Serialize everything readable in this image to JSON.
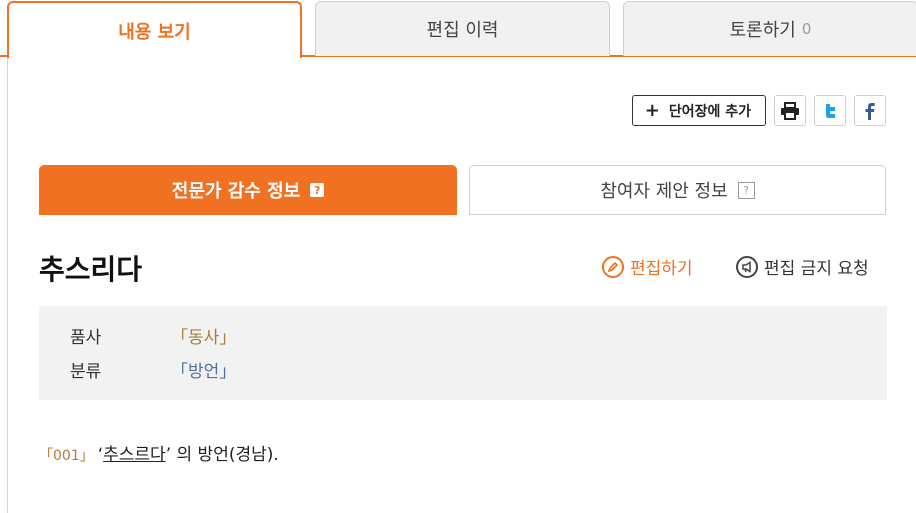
{
  "tabs": {
    "view": "내용 보기",
    "history": "편집 이력",
    "discuss": "토론하기",
    "discuss_count": "0"
  },
  "toolbar": {
    "add_vocab": "단어장에 추가",
    "add_vocab_symbol": "+",
    "print_icon": "printer-icon",
    "twitter_icon": "twitter-icon",
    "facebook_icon": "facebook-icon"
  },
  "subtabs": {
    "expert": "전문가 감수 정보",
    "participant": "참여자 제안 정보",
    "help_mark": "?"
  },
  "entry": {
    "word": "추스리다",
    "edit": "편집하기",
    "ban_request": "편집 금지 요청"
  },
  "info": {
    "pos_label": "품사",
    "pos_value": "「동사」",
    "category_label": "분류",
    "category_value": "「방언」"
  },
  "definition": {
    "number": "「001」",
    "open_quote": "‘",
    "word": "추스르다",
    "text": "’ 의 방언(경남)."
  },
  "colors": {
    "accent": "#f07122",
    "info_bg": "#f2f2f2"
  }
}
